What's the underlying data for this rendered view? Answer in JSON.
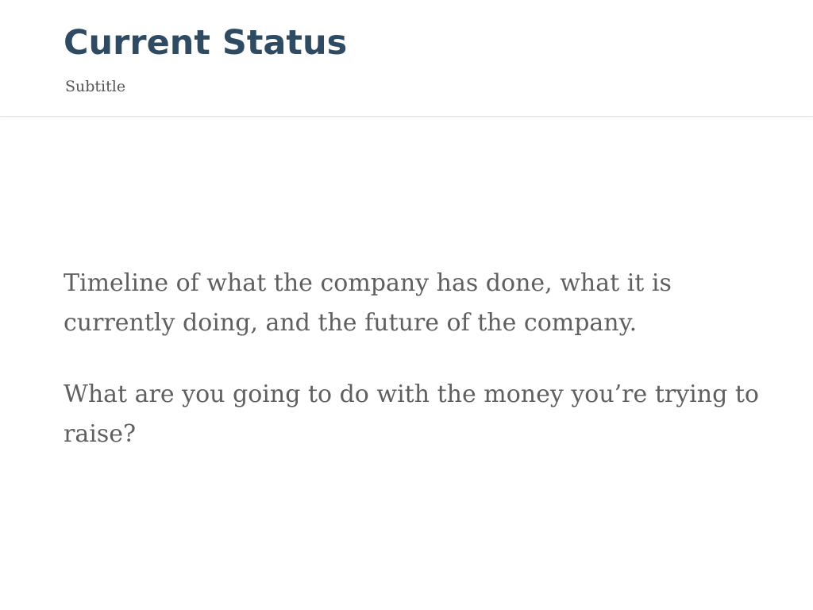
{
  "header": {
    "title": "Current Status",
    "subtitle": "Subtitle"
  },
  "content": {
    "paragraphs": [
      "Timeline of what the company has done, what it is currently doing, and the future of the company.",
      "What are you going to do with the money you’re trying to raise?"
    ]
  },
  "colors": {
    "title": "#2f4b63",
    "subtitle": "#555555",
    "body_text": "#5f5f5f",
    "background": "#ffffff"
  }
}
